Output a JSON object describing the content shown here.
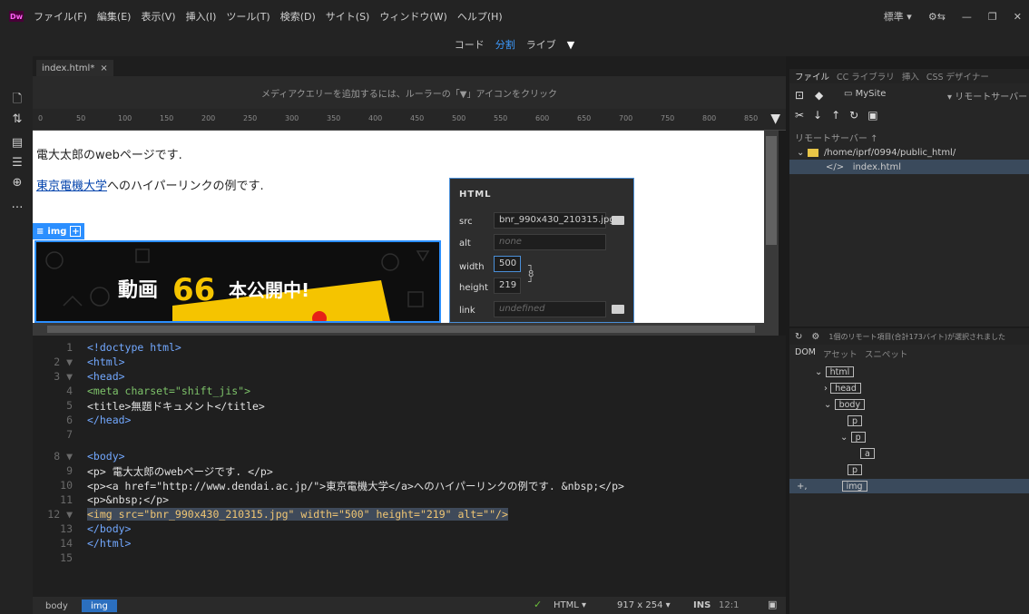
{
  "app": {
    "logo": "Dw"
  },
  "menu": [
    "ファイル(F)",
    "編集(E)",
    "表示(V)",
    "挿入(I)",
    "ツール(T)",
    "検索(D)",
    "サイト(S)",
    "ウィンドウ(W)",
    "ヘルプ(H)"
  ],
  "workspace": "標準",
  "view_modes": [
    "コード",
    "分割",
    "ライブ"
  ],
  "active_view": "分割",
  "doc_tab": "index.html*",
  "media_query_hint": "メディアクエリーを追加するには、ルーラーの「▼」アイコンをクリック",
  "ruler_ticks": [
    "0",
    "50",
    "100",
    "150",
    "200",
    "250",
    "300",
    "350",
    "400",
    "450",
    "500",
    "550",
    "600",
    "650",
    "700",
    "750",
    "800",
    "850"
  ],
  "design": {
    "line1": "電大太郎のwebページです.",
    "link_text": "東京電機大学",
    "line2_rest": "へのハイパーリンクの例です.",
    "img_tag": "img",
    "banner_text_1": "動画",
    "banner_num": "66",
    "banner_text_2": "本公開中!"
  },
  "hud": {
    "title": "HTML",
    "src_label": "src",
    "src_value": "bnr_990x430_210315.jpg",
    "alt_label": "alt",
    "alt_placeholder": "none",
    "width_label": "width",
    "width_value": "500",
    "height_label": "height",
    "height_value": "219",
    "link_label": "link",
    "link_placeholder": "undefined"
  },
  "code_lines": [
    {
      "n": "1",
      "fold": "",
      "text": "<!doctype html>"
    },
    {
      "n": "2",
      "fold": "▼",
      "text": "<html>"
    },
    {
      "n": "3",
      "fold": "▼",
      "text": "<head>"
    },
    {
      "n": "4",
      "fold": "",
      "text": "<meta charset=\"shift_jis\">"
    },
    {
      "n": "5",
      "fold": "",
      "text": "<title>無題ドキュメント</title>"
    },
    {
      "n": "6",
      "fold": "",
      "text": "</head>"
    },
    {
      "n": "7",
      "fold": "",
      "text": ""
    },
    {
      "n": "8",
      "fold": "▼",
      "text": "<body>"
    },
    {
      "n": "9",
      "fold": "",
      "text": "<p> 電大太郎のwebページです. </p>"
    },
    {
      "n": "10",
      "fold": "",
      "text": "<p><a href=\"http://www.dendai.ac.jp/\">東京電機大学</a>へのハイパーリンクの例です. &nbsp;</p>"
    },
    {
      "n": "11",
      "fold": "",
      "text": "<p>&nbsp;</p>"
    },
    {
      "n": "12",
      "fold": "▼",
      "text": "<img src=\"bnr_990x430_210315.jpg\" width=\"500\" height=\"219\" alt=\"\"/>"
    },
    {
      "n": "13",
      "fold": "",
      "text": "</body>"
    },
    {
      "n": "14",
      "fold": "",
      "text": "</html>"
    },
    {
      "n": "15",
      "fold": "",
      "text": ""
    }
  ],
  "status": {
    "crumb_body": "body",
    "crumb_img": "img",
    "lang": "HTML",
    "size": "917 x 254",
    "mode": "INS",
    "pos": "12:1"
  },
  "files_panel": {
    "tabs": [
      "ファイル",
      "CC ライブラリ",
      "挿入",
      "CSS デザイナー"
    ],
    "site": "MySite",
    "server": "リモートサーバー",
    "section": "リモートサーバー",
    "folder": "/home/iprf/0994/public_html/",
    "file": "index.html",
    "status_msg": "1個のリモート項目(合計173バイト)が選択されました"
  },
  "dom_panel": {
    "tabs": [
      "DOM",
      "アセット",
      "スニペット"
    ],
    "nodes": [
      "html",
      "head",
      "body",
      "p",
      "p",
      "a",
      "p",
      "img"
    ]
  }
}
